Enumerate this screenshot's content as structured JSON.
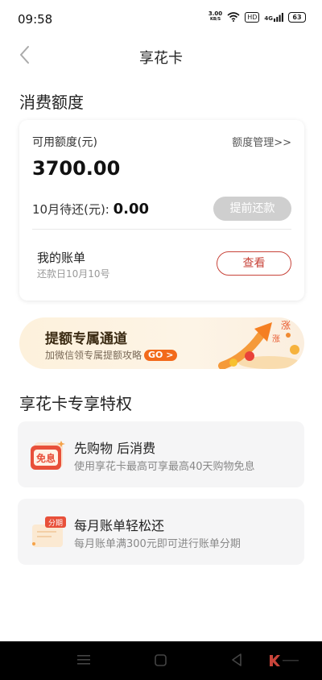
{
  "status": {
    "time": "09:58",
    "speed_value": "3.00",
    "speed_unit": "KB/S",
    "hd": "HD",
    "network": "4G",
    "battery": "63"
  },
  "header": {
    "title": "享花卡"
  },
  "quota": {
    "section_title": "消费额度",
    "available_label": "可用额度(元)",
    "manage_link": "额度管理>>",
    "amount": "3700.00",
    "due_label": "10月待还(元):",
    "due_value": "0.00",
    "repay_button": "提前还款",
    "bill_title": "我的账单",
    "bill_sub": "还款日10月10号",
    "view_button": "查看"
  },
  "banner": {
    "title": "提额专属通道",
    "subtitle": "加微信领专属提额攻略",
    "go_label": "GO",
    "go_arrow": ">",
    "decor_text": "涨"
  },
  "perks": {
    "section_title": "享花卡专享特权",
    "items": [
      {
        "icon": "free-interest-icon",
        "badge": "免息",
        "title": "先购物 后消费",
        "subtitle": "使用享花卡最高可享最高40天购物免息"
      },
      {
        "icon": "installment-icon",
        "badge": "分期",
        "title": "每月账单轻松还",
        "subtitle": "每月账单满300元即可进行账单分期"
      }
    ]
  },
  "nav": {
    "menu_icon": "menu-icon",
    "home_icon": "home-icon",
    "back_icon": "back-triangle-icon",
    "brand_icon": "brand-k-icon"
  },
  "colors": {
    "accent_red": "#c8443a",
    "banner_orange": "#f26a1b",
    "disabled_gray": "#cfcfcf"
  }
}
